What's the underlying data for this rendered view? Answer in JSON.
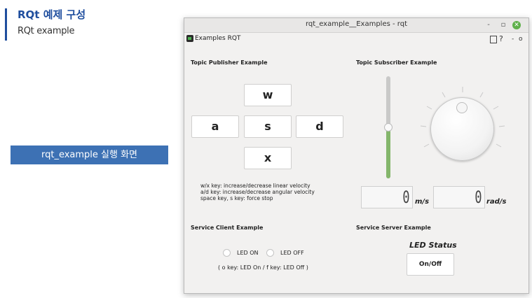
{
  "slide": {
    "title": "RQt 예제 구성",
    "subtitle": "RQt example",
    "caption": "rqt_example 실행 화면"
  },
  "window": {
    "title": "rqt_example__Examples - rqt",
    "controls": {
      "minimize": "-",
      "maximize": "▫",
      "close": "✕"
    }
  },
  "plugin": {
    "name": "Examples RQT",
    "controls": {
      "help": "?",
      "minimize": "-",
      "close": "o"
    }
  },
  "publisher": {
    "title": "Topic Publisher Example",
    "keys": {
      "w": "w",
      "a": "a",
      "s": "s",
      "d": "d",
      "x": "x"
    },
    "help": [
      "w/x key: increase/decrease linear velocity",
      "a/d key: increase/decrease angular velocity",
      "space key, s key: force stop"
    ]
  },
  "subscriber": {
    "title": "Topic Subscriber Example",
    "linear_display": "0",
    "linear_unit": "m/s",
    "angular_display": "0",
    "angular_unit": "rad/s",
    "slider_fill_fraction": 0.5
  },
  "client": {
    "title": "Service Client Example",
    "led_on": "LED ON",
    "led_off": "LED OFF",
    "help": "( o key: LED On / f key: LED Off )"
  },
  "server": {
    "title": "Service Server Example",
    "status_label": "LED Status",
    "button": "On/Off"
  },
  "colors": {
    "accent": "#1f4e9e",
    "caption_bg": "#3d71b4",
    "slider_fill": "#84b66b",
    "close_button": "#5eb04a"
  }
}
